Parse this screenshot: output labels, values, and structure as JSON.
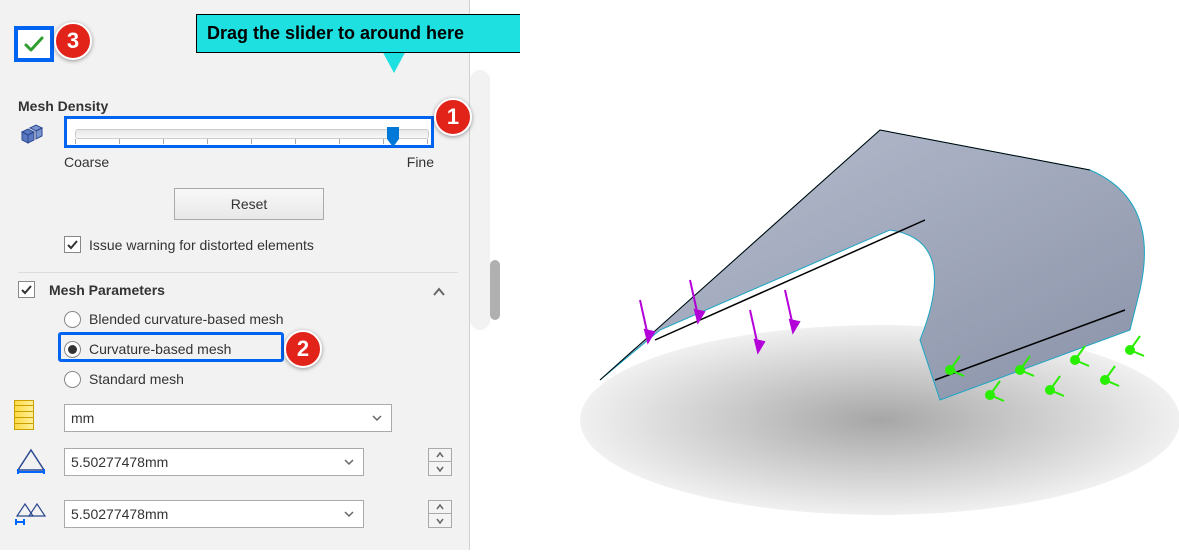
{
  "callout": {
    "text": "Drag the slider to around here"
  },
  "badges": {
    "1": "1",
    "2": "2",
    "3": "3"
  },
  "mesh_density": {
    "title": "Mesh Density",
    "coarse": "Coarse",
    "fine": "Fine",
    "reset": "Reset",
    "warn": "Issue warning for distorted elements",
    "warn_checked": true
  },
  "mesh_params": {
    "title": "Mesh Parameters",
    "checked": true,
    "options": {
      "blended": "Blended curvature-based mesh",
      "curvature": "Curvature-based mesh",
      "standard": "Standard mesh"
    },
    "selected": "curvature",
    "unit": "mm",
    "max_size": "5.50277478mm",
    "min_size": "5.50277478mm"
  }
}
